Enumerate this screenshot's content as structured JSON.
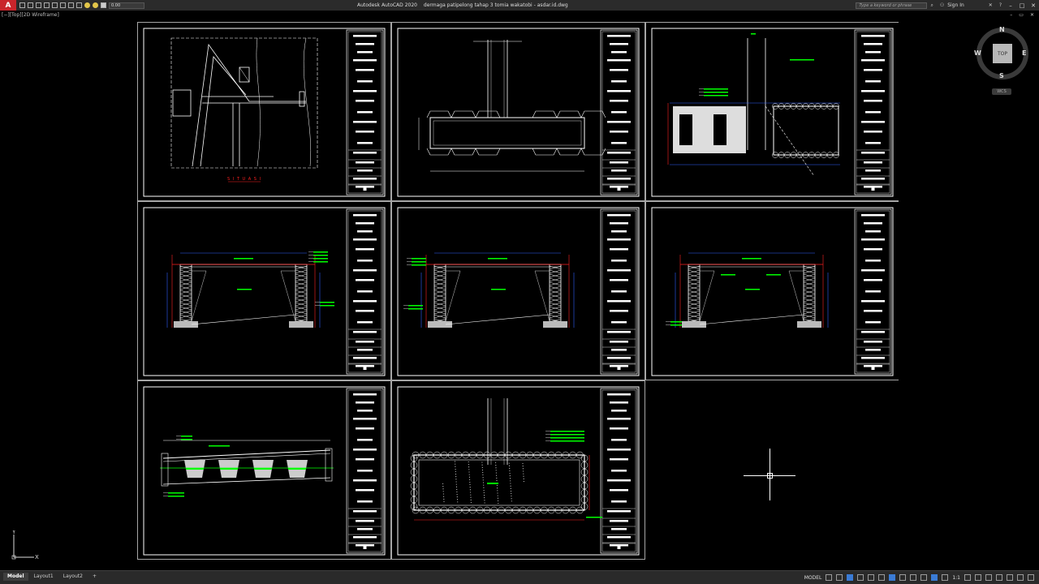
{
  "titlebar": {
    "app_logo": "A",
    "lineweight_value": "0.00",
    "app_name": "Autodesk AutoCAD 2020",
    "file_name": "dermaga patipelong tahap 3 tomia wakatobi - asdar.id.dwg",
    "search_placeholder": "Type a keyword or phrase",
    "sign_in": "Sign In"
  },
  "viewport": {
    "label": "[−][Top][2D Wireframe]"
  },
  "viewcube": {
    "top": "TOP",
    "north": "N",
    "south": "S",
    "east": "E",
    "west": "W",
    "wcs": "WCS"
  },
  "drawing": {
    "situasi_title": "S I T U A S I"
  },
  "ucs": {
    "x": "X",
    "y": "Y"
  },
  "statusbar": {
    "tabs": [
      "Model",
      "Layout1",
      "Layout2"
    ],
    "model_label": "MODEL",
    "scale": "1:1"
  },
  "colors": {
    "line": "#ffffff",
    "green": "#00ff00",
    "red": "#ff2020",
    "blue": "#3060ff",
    "frame": "#d0d0d0"
  }
}
